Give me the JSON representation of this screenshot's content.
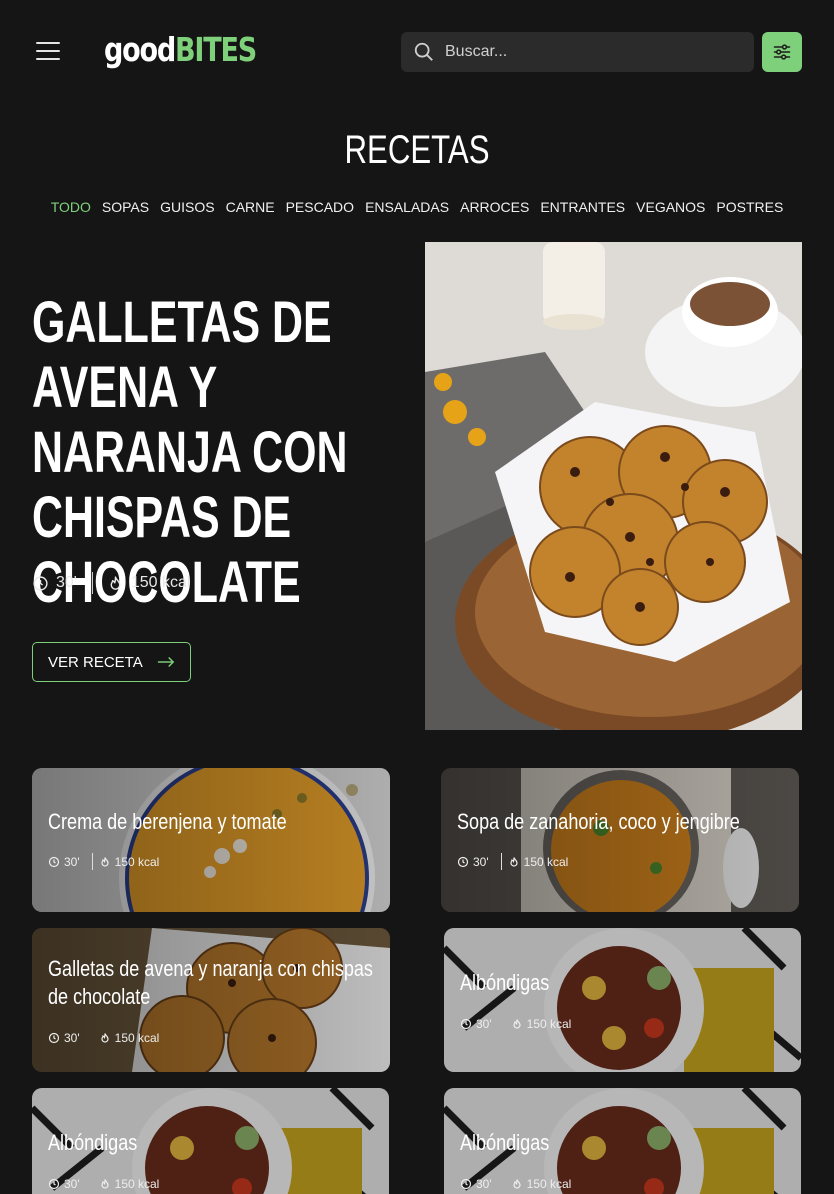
{
  "header": {
    "logo_part1": "good",
    "logo_part2": "BITES",
    "search_placeholder": "Buscar...",
    "accent_color": "#7fd07a"
  },
  "page_title": "RECETAS",
  "categories": [
    "TODO",
    "SOPAS",
    "GUISOS",
    "CARNE",
    "PESCADO",
    "ENSALADAS",
    "ARROCES",
    "ENTRANTES",
    "VEGANOS",
    "POSTRES"
  ],
  "active_category": "TODO",
  "hero": {
    "title": "GALLETAS DE AVENA Y NARANJA CON CHISPAS DE CHOCOLATE",
    "time": "30'",
    "kcal": "150 kcal",
    "cta_label": "VER RECETA"
  },
  "cards": [
    {
      "title": "Crema de berenjena y tomate",
      "time": "30'",
      "kcal": "150 kcal"
    },
    {
      "title": "Sopa de zanahoria, coco y jengibre",
      "time": "30'",
      "kcal": "150 kcal"
    },
    {
      "title": "Galletas de avena y naranja con chispas de chocolate",
      "time": "30'",
      "kcal": "150 kcal"
    },
    {
      "title": "Albóndigas",
      "time": "30'",
      "kcal": "150 kcal"
    },
    {
      "title": "Albóndigas",
      "time": "30'",
      "kcal": "150 kcal"
    },
    {
      "title": "Albóndigas",
      "time": "30'",
      "kcal": "150 kcal"
    }
  ]
}
